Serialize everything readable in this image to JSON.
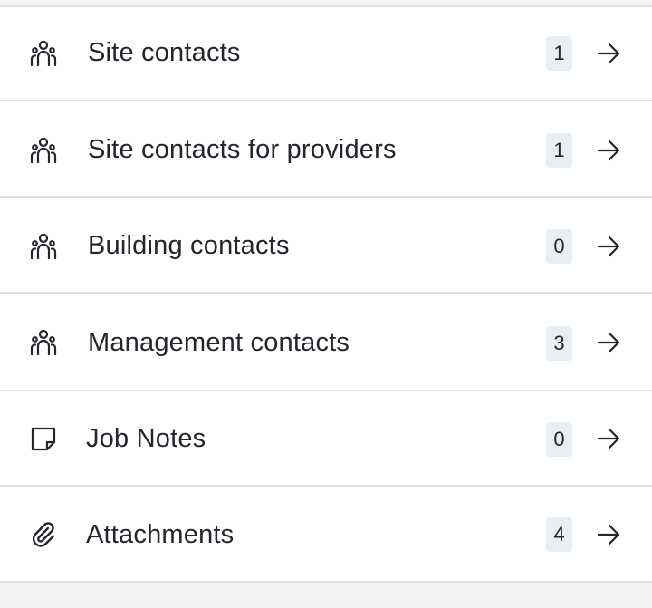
{
  "items": [
    {
      "label": "Site contacts",
      "count": "1",
      "icon": "people-icon"
    },
    {
      "label": "Site contacts for providers",
      "count": "1",
      "icon": "people-icon"
    },
    {
      "label": "Building contacts",
      "count": "0",
      "icon": "people-icon"
    },
    {
      "label": "Management contacts",
      "count": "3",
      "icon": "people-icon"
    },
    {
      "label": "Job Notes",
      "count": "0",
      "icon": "sticky-note-icon"
    },
    {
      "label": "Attachments",
      "count": "4",
      "icon": "paperclip-icon"
    }
  ],
  "colors": {
    "text": "#23262b",
    "badge_bg": "#e9eef2",
    "divider": "#dedfe1",
    "row_bg": "#ffffff"
  }
}
